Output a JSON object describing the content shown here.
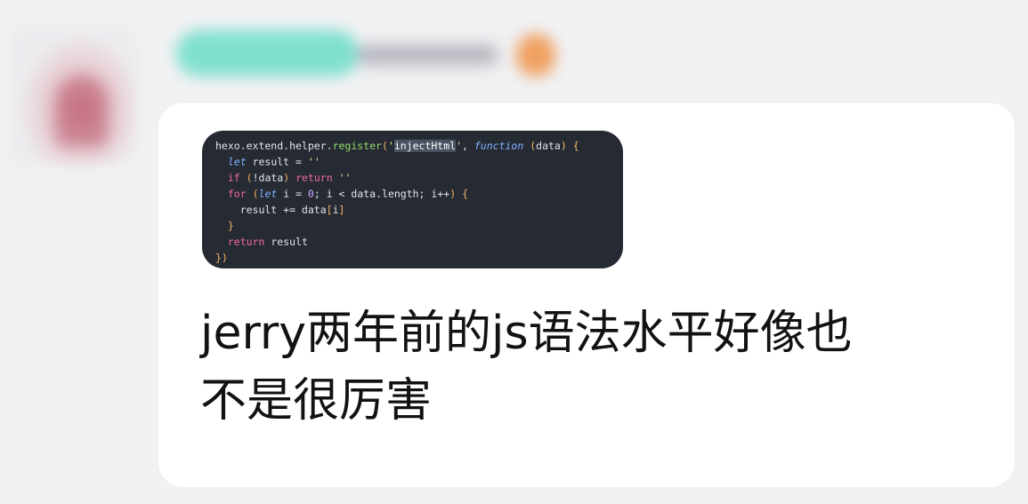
{
  "chat": {
    "message": {
      "code_image": {
        "lines": [
          "hexo.extend.helper.register('injectHtml', function (data) {",
          "  let result = ''",
          "  if (!data) return ''",
          "  for (let i = 0; i < data.length; i++) {",
          "    result += data[i]",
          "  }",
          "  return result",
          "})"
        ]
      },
      "text_line_1": "jerry两年前的js语法水平好像也",
      "text_line_2": "不是很厉害"
    }
  }
}
